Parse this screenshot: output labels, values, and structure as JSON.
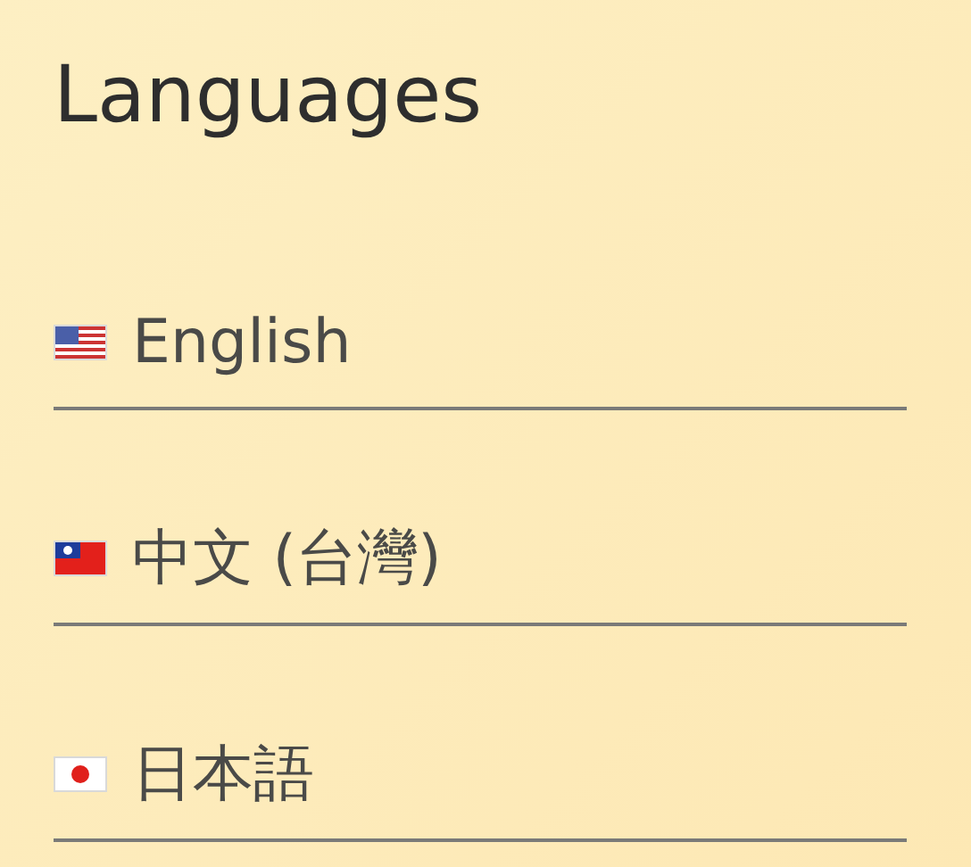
{
  "title": "Languages",
  "languages": [
    {
      "label": "English",
      "kind": "us"
    },
    {
      "label": "中文 (台灣)",
      "kind": "tw"
    },
    {
      "label": "日本語",
      "kind": "jp"
    }
  ]
}
